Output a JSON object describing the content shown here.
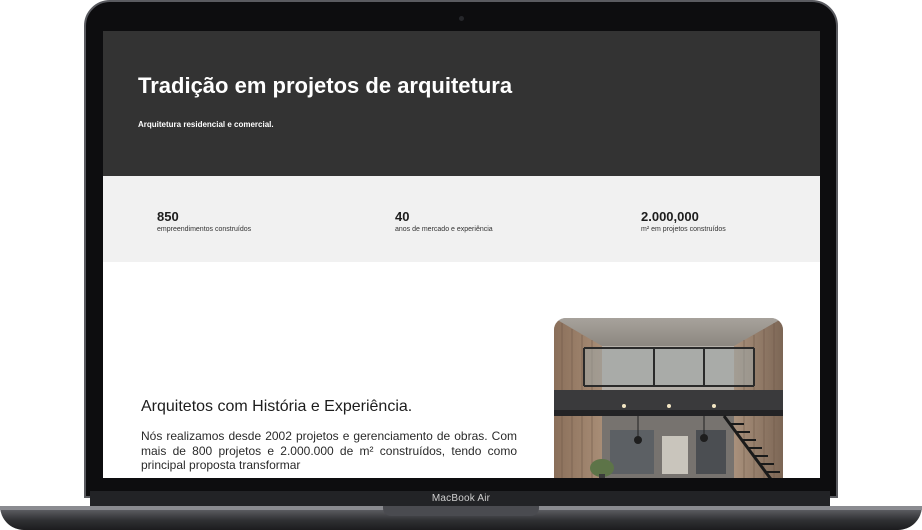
{
  "hero": {
    "title": "Tradição em projetos de arquitetura",
    "subtitle": "Arquitetura residencial e comercial."
  },
  "stats": [
    {
      "value": "850",
      "label": "empreendimentos construídos"
    },
    {
      "value": "40",
      "label": "anos de mercado e experiência"
    },
    {
      "value": "2.000,000",
      "label": "m² em projetos construídos"
    }
  ],
  "about": {
    "title": "Arquitetos com História e Experiência.",
    "text": "Nós realizamos desde 2002 projetos e gerenciamento de obras. Com mais de 800 projetos e 2.000.000 de m² construídos, tendo como principal proposta transformar"
  },
  "device": {
    "label": "MacBook Air"
  },
  "colors": {
    "hero_bg": "#333333",
    "stats_bg": "#f1f1f1",
    "text_dark": "#1d1d1d"
  }
}
